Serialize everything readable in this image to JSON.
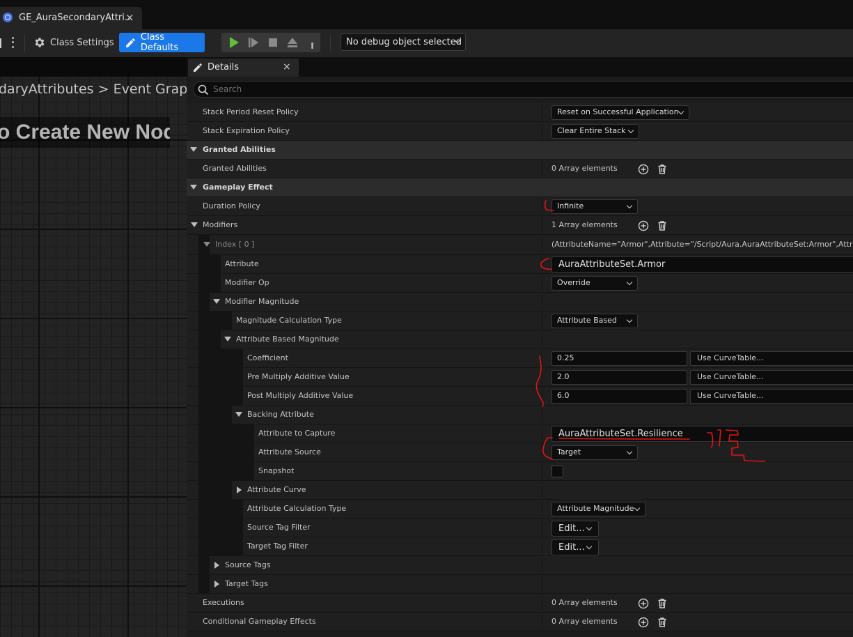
{
  "window": {
    "tab_title": "GE_AuraSecondaryAttri...",
    "tab_close": "×"
  },
  "toolbar": {
    "class_settings": "Class Settings",
    "class_defaults": "Class Defaults",
    "debug_selector": "No debug object selected"
  },
  "graph": {
    "breadcrumb_asset": "daryAttributes",
    "breadcrumb_separator": ">",
    "breadcrumb_graph": "Event Graph",
    "hint": "o Create New Nodes"
  },
  "details": {
    "tab_label": "Details",
    "tab_close": "×",
    "search_placeholder": "Search",
    "rows": {
      "stack_period": {
        "label": "Stack Period Reset Policy",
        "value": "Reset on Successful Application"
      },
      "stack_expiration": {
        "label": "Stack Expiration Policy",
        "value": "Clear Entire Stack"
      },
      "cat_granted": {
        "label": "Granted Abilities"
      },
      "granted_abilities": {
        "label": "Granted Abilities",
        "value": "0 Array elements"
      },
      "cat_gameplay": {
        "label": "Gameplay Effect"
      },
      "duration_policy": {
        "label": "Duration Policy",
        "value": "Infinite"
      },
      "modifiers": {
        "label": "Modifiers",
        "value": "1 Array elements"
      },
      "index0": {
        "label": "Index [ 0 ]",
        "value": "(AttributeName=\"Armor\",Attribute=\"/Script/Aura.AuraAttributeSet:Armor\",AttributeOwn"
      },
      "attribute": {
        "label": "Attribute",
        "value": "AuraAttributeSet.Armor"
      },
      "modifier_op": {
        "label": "Modifier Op",
        "value": "Override"
      },
      "modifier_magnitude": {
        "label": "Modifier Magnitude"
      },
      "magnitude_calc_type": {
        "label": "Magnitude Calculation Type",
        "value": "Attribute Based"
      },
      "attr_based_magnitude": {
        "label": "Attribute Based Magnitude"
      },
      "coefficient": {
        "label": "Coefficient",
        "value": "0.25",
        "curve": "Use CurveTable..."
      },
      "pre_multiply": {
        "label": "Pre Multiply Additive Value",
        "value": "2.0",
        "curve": "Use CurveTable..."
      },
      "post_multiply": {
        "label": "Post Multiply Additive Value",
        "value": "6.0",
        "curve": "Use CurveTable..."
      },
      "backing_attribute": {
        "label": "Backing Attribute"
      },
      "attr_to_capture": {
        "label": "Attribute to Capture",
        "value": "AuraAttributeSet.Resilience"
      },
      "attr_source": {
        "label": "Attribute Source",
        "value": "Target"
      },
      "snapshot": {
        "label": "Snapshot",
        "checked": false
      },
      "attr_curve": {
        "label": "Attribute Curve"
      },
      "attr_calc_type": {
        "label": "Attribute Calculation Type",
        "value": "Attribute Magnitude"
      },
      "source_tag_filter": {
        "label": "Source Tag Filter",
        "value": "Edit..."
      },
      "target_tag_filter": {
        "label": "Target Tag Filter",
        "value": "Edit..."
      },
      "source_tags": {
        "label": "Source Tags"
      },
      "target_tags": {
        "label": "Target Tags"
      },
      "executions": {
        "label": "Executions",
        "value": "0 Array elements"
      },
      "conditional_effects": {
        "label": "Conditional Gameplay Effects",
        "value": "0 Array elements"
      }
    }
  },
  "colors": {
    "accent": "#1a78e8",
    "play_green": "#5fbf3a",
    "annotation_red": "#e21414"
  },
  "icons": [
    "unreal-logo-icon",
    "gear-icon",
    "pencil-icon",
    "play-icon",
    "step-icon",
    "stop-icon",
    "eject-icon",
    "search-icon",
    "add-icon",
    "trash-icon",
    "chevron-down-icon"
  ]
}
